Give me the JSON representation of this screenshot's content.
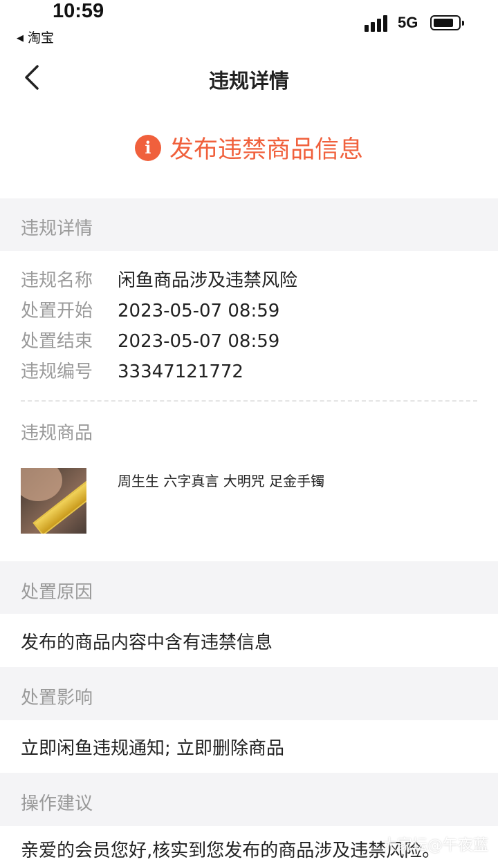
{
  "status_bar": {
    "time": "10:59",
    "back_app": "淘宝",
    "network": "5G"
  },
  "nav": {
    "title": "违规详情"
  },
  "banner": {
    "icon_glyph": "i",
    "text": "发布违禁商品信息",
    "color": "#f0603c"
  },
  "details": {
    "section_title": "违规详情",
    "rows": [
      {
        "label": "违规名称",
        "value": "闲鱼商品涉及违禁风险"
      },
      {
        "label": "处置开始",
        "value": "2023-05-07 08:59"
      },
      {
        "label": "处置结束",
        "value": "2023-05-07 08:59"
      },
      {
        "label": "违规编号",
        "value": "33347121772"
      }
    ],
    "goods_title": "违规商品",
    "product_name": "周生生 六字真言 大明咒 足金手镯"
  },
  "reason": {
    "section_title": "处置原因",
    "text": "发布的商品内容中含有违禁信息"
  },
  "impact": {
    "section_title": "处置影响",
    "text": "立即闲鱼违规通知; 立即删除商品"
  },
  "advice": {
    "section_title": "操作建议",
    "text": "亲爱的会员您好,核实到您发布的商品涉及违禁风险。"
  },
  "watermark": "大家坛@午夜蓝"
}
